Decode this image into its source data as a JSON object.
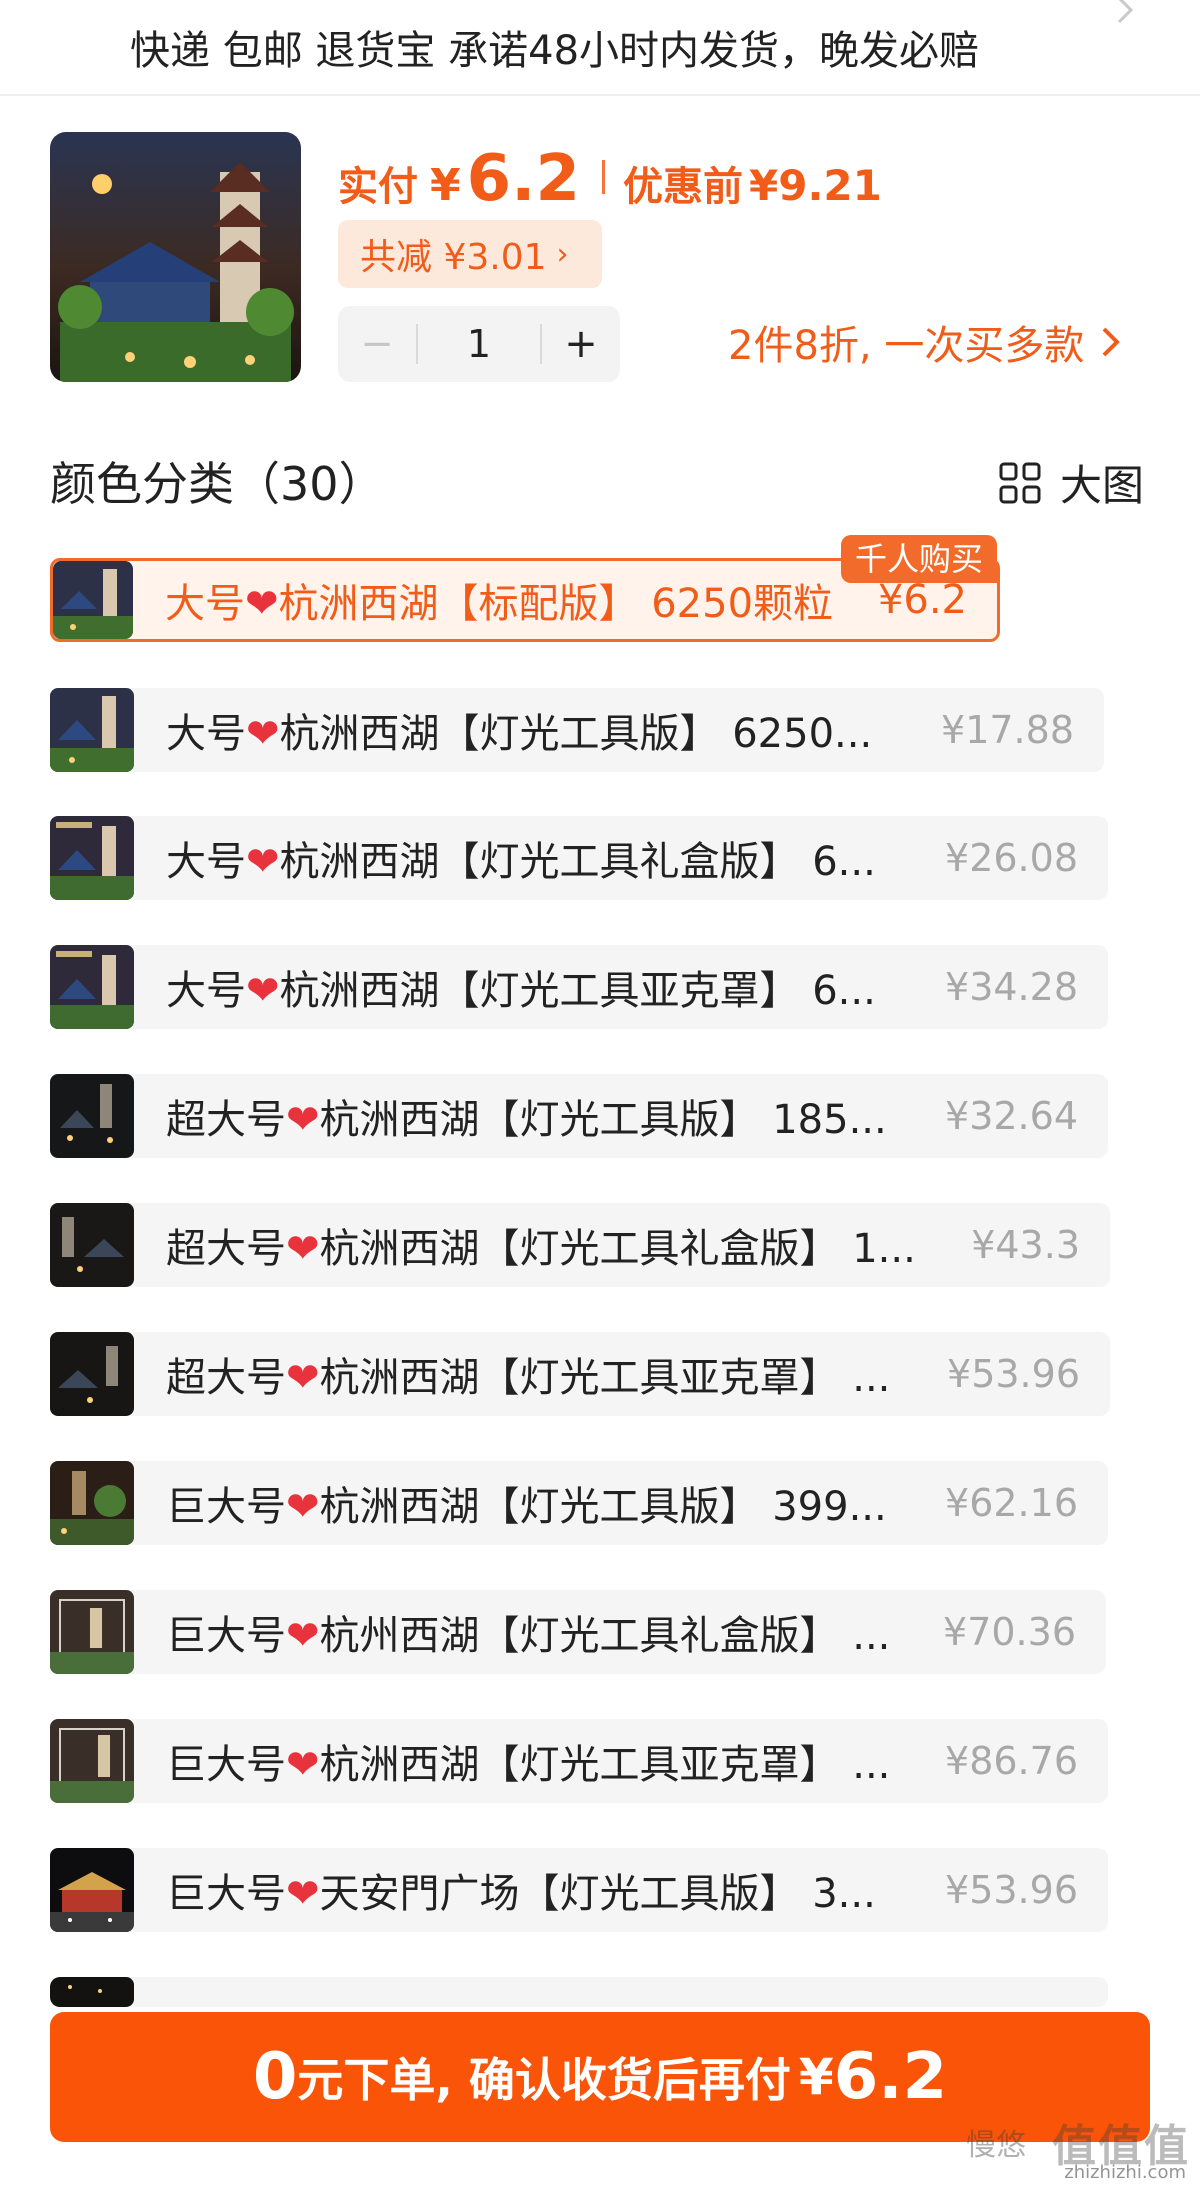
{
  "service_bar": {
    "text": "快递 包邮 退货宝 承诺48小时内发货，晚发必赔"
  },
  "summary": {
    "paid_label": "实付",
    "currency": "¥",
    "paid_value": "6.2",
    "original_label": "优惠前",
    "original_value": "¥9.21",
    "discount_text": "共减 ¥3.01",
    "quantity": "1",
    "promo_text": "2件8折, 一次买多款"
  },
  "section": {
    "title": "颜色分类（30）",
    "view_label": "大图"
  },
  "options": [
    {
      "prefix": "大号",
      "name": "杭洲西湖【标配版】 6250颗粒",
      "price": "¥6.2",
      "badge": "千人购买"
    },
    {
      "prefix": "大号",
      "name": "杭洲西湖【灯光工具版】 6250...",
      "price": "¥17.88"
    },
    {
      "prefix": "大号",
      "name": "杭洲西湖【灯光工具礼盒版】 6...",
      "price": "¥26.08"
    },
    {
      "prefix": "大号",
      "name": "杭洲西湖【灯光工具亚克罩】 6...",
      "price": "¥34.28"
    },
    {
      "prefix": "超大号",
      "name": "杭洲西湖【灯光工具版】 185...",
      "price": "¥32.64"
    },
    {
      "prefix": "超大号",
      "name": "杭洲西湖【灯光工具礼盒版】 1...",
      "price": "¥43.3"
    },
    {
      "prefix": "超大号",
      "name": "杭洲西湖【灯光工具亚克罩】 ...",
      "price": "¥53.96"
    },
    {
      "prefix": "巨大号",
      "name": "杭洲西湖【灯光工具版】 399...",
      "price": "¥62.16"
    },
    {
      "prefix": "巨大号",
      "name": "杭州西湖【灯光工具礼盒版】 ...",
      "price": "¥70.36"
    },
    {
      "prefix": "巨大号",
      "name": "杭洲西湖【灯光工具亚克罩】 ...",
      "price": "¥86.76"
    },
    {
      "prefix": "巨大号",
      "name": "天安門广场【灯光工具版】 3...",
      "price": "¥53.96"
    }
  ],
  "cta": {
    "zero": "0",
    "text": "元下单, 确认收货后再付",
    "currency": "¥",
    "amount": "6.2"
  },
  "watermark": {
    "main": "值值值",
    "side": "慢悠",
    "site": "zhizhizhi.com"
  },
  "colors": {
    "accent": "#f25c19",
    "cta_bg": "#fa5408",
    "heart": "#e8323c"
  }
}
